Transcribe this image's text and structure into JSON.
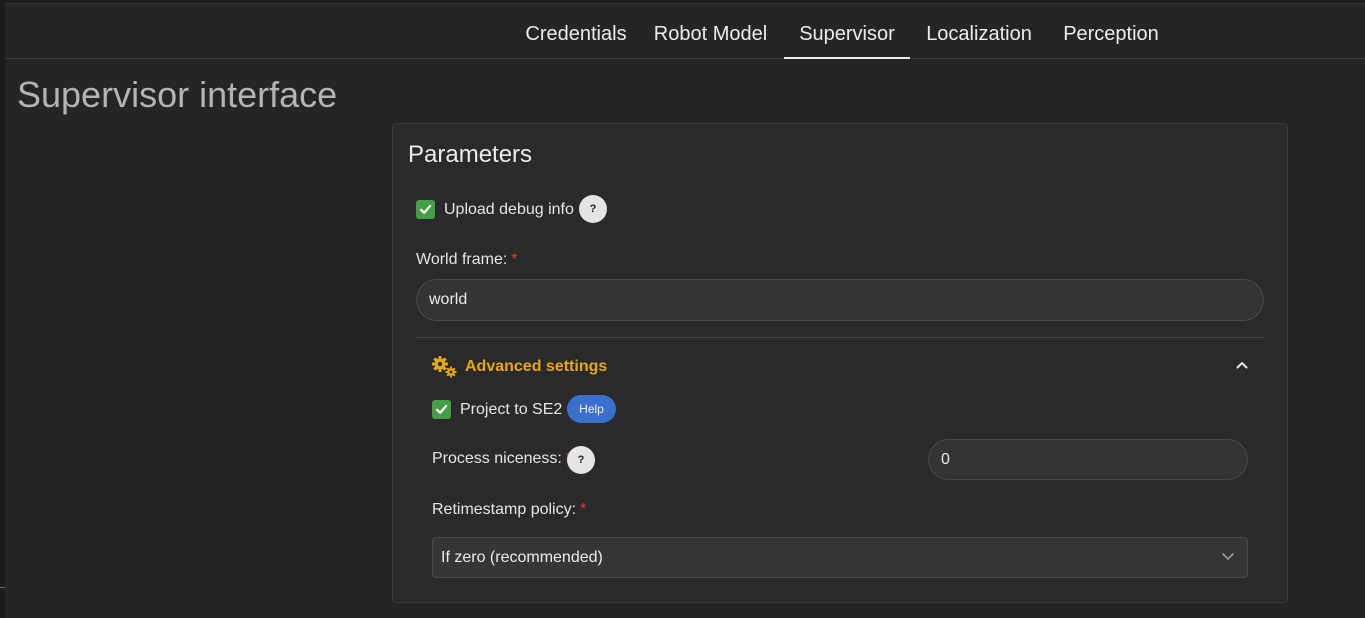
{
  "tabs": [
    {
      "label": "Credentials",
      "active": false
    },
    {
      "label": "Robot Model",
      "active": false
    },
    {
      "label": "Supervisor",
      "active": true
    },
    {
      "label": "Localization",
      "active": false
    },
    {
      "label": "Perception",
      "active": false
    }
  ],
  "page_title": "Supervisor interface",
  "card": {
    "title": "Parameters",
    "upload_debug": {
      "label": "Upload debug info",
      "checked": true,
      "help_icon": "?"
    },
    "world_frame": {
      "label": "World frame:",
      "required_mark": "*",
      "value": "world"
    },
    "advanced": {
      "title": "Advanced settings",
      "icon": "gears-icon",
      "expanded": true,
      "project_se2": {
        "label": "Project to SE2",
        "checked": true,
        "help_label": "Help"
      },
      "process_niceness": {
        "label": "Process niceness:",
        "required_mark": "*",
        "help_icon": "?",
        "value": "0"
      },
      "retimestamp": {
        "label": "Retimestamp policy:",
        "required_mark": "*",
        "selected": "If zero (recommended)"
      }
    }
  },
  "colors": {
    "accent_gold": "#e6a815",
    "checkbox_green": "#43a047",
    "help_blue": "#3b6fce",
    "required_red": "#e53935"
  }
}
